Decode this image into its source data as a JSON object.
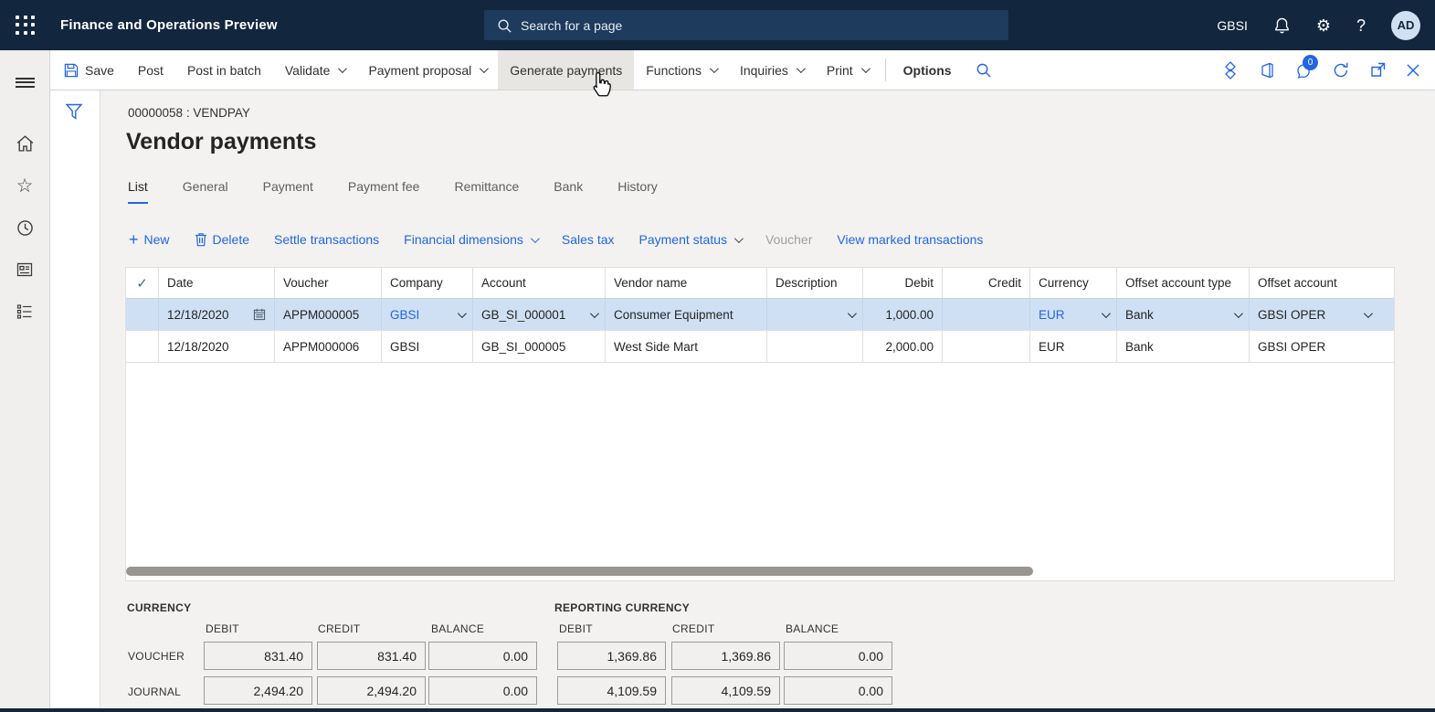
{
  "colors": {
    "accent": "#2266E3",
    "topbar_bg": "#12263E",
    "selected_row": "#CFE0F5"
  },
  "icons": {
    "checkmark": "✓",
    "plus": "+",
    "gear": "⚙",
    "question": "?",
    "star": "☆"
  },
  "topbar": {
    "title": "Finance and Operations Preview",
    "search_placeholder": "Search for a page",
    "company": "GBSI",
    "avatar": "AD"
  },
  "actionbar": {
    "save": "Save",
    "post": "Post",
    "post_in_batch": "Post in batch",
    "validate": "Validate",
    "payment_proposal": "Payment proposal",
    "generate_payments": "Generate payments",
    "functions": "Functions",
    "inquiries": "Inquiries",
    "print": "Print",
    "options": "Options",
    "badge_count": "0"
  },
  "page": {
    "caption": "00000058 : VENDPAY",
    "title": "Vendor payments"
  },
  "tabs": {
    "list": "List",
    "general": "General",
    "payment": "Payment",
    "payment_fee": "Payment fee",
    "remittance": "Remittance",
    "bank": "Bank",
    "history": "History"
  },
  "gtoolbar": {
    "new": "New",
    "delete": "Delete",
    "settle": "Settle transactions",
    "financial_dimensions": "Financial dimensions",
    "sales_tax": "Sales tax",
    "payment_status": "Payment status",
    "voucher": "Voucher",
    "view_marked": "View marked transactions"
  },
  "grid": {
    "headers": {
      "date": "Date",
      "voucher": "Voucher",
      "company": "Company",
      "account": "Account",
      "vendor": "Vendor name",
      "description": "Description",
      "debit": "Debit",
      "credit": "Credit",
      "currency": "Currency",
      "offset_type": "Offset account type",
      "offset": "Offset account"
    },
    "rows": [
      {
        "date": "12/18/2020",
        "voucher": "APPM000005",
        "company": "GBSI",
        "account": "GB_SI_000001",
        "vendor": "Consumer Equipment",
        "description": "",
        "debit": "1,000.00",
        "credit": "",
        "currency": "EUR",
        "offset_type": "Bank",
        "offset": "GBSI OPER"
      },
      {
        "date": "12/18/2020",
        "voucher": "APPM000006",
        "company": "GBSI",
        "account": "GB_SI_000005",
        "vendor": "West Side Mart",
        "description": "",
        "debit": "2,000.00",
        "credit": "",
        "currency": "EUR",
        "offset_type": "Bank",
        "offset": "GBSI OPER"
      }
    ]
  },
  "totals": {
    "currency_label": "CURRENCY",
    "reporting_label": "REPORTING CURRENCY",
    "headers": {
      "debit": "DEBIT",
      "credit": "CREDIT",
      "balance": "BALANCE"
    },
    "row_labels": {
      "voucher": "VOUCHER",
      "journal": "JOURNAL"
    },
    "currency": {
      "voucher": {
        "debit": "831.40",
        "credit": "831.40",
        "balance": "0.00"
      },
      "journal": {
        "debit": "2,494.20",
        "credit": "2,494.20",
        "balance": "0.00"
      }
    },
    "reporting": {
      "voucher": {
        "debit": "1,369.86",
        "credit": "1,369.86",
        "balance": "0.00"
      },
      "journal": {
        "debit": "4,109.59",
        "credit": "4,109.59",
        "balance": "0.00"
      }
    }
  }
}
